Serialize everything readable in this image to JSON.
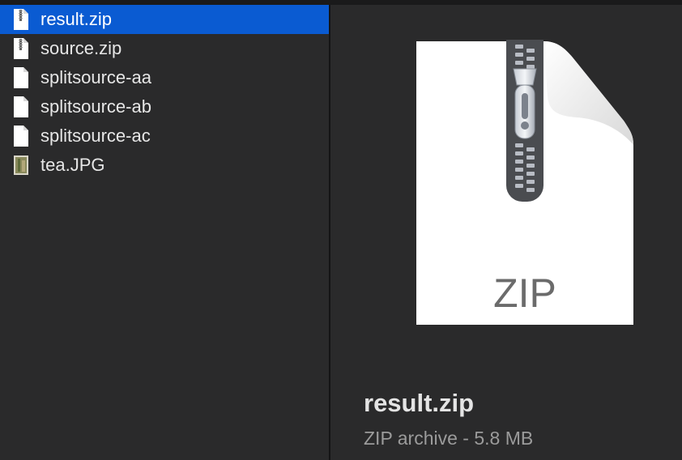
{
  "files": [
    {
      "name": "result.zip",
      "icon": "zip-file-icon",
      "selected": true
    },
    {
      "name": "source.zip",
      "icon": "zip-file-icon",
      "selected": false
    },
    {
      "name": "splitsource-aa",
      "icon": "blank-file-icon",
      "selected": false
    },
    {
      "name": "splitsource-ab",
      "icon": "blank-file-icon",
      "selected": false
    },
    {
      "name": "splitsource-ac",
      "icon": "blank-file-icon",
      "selected": false
    },
    {
      "name": "tea.JPG",
      "icon": "image-thumbnail-icon",
      "selected": false
    }
  ],
  "preview": {
    "icon_label": "ZIP",
    "name": "result.zip",
    "meta": "ZIP archive - 5.8 MB"
  },
  "colors": {
    "background": "#2a2a2b",
    "selection": "#0a5bd2",
    "text": "#e6e6e6",
    "meta_text": "#9b9b9b"
  }
}
